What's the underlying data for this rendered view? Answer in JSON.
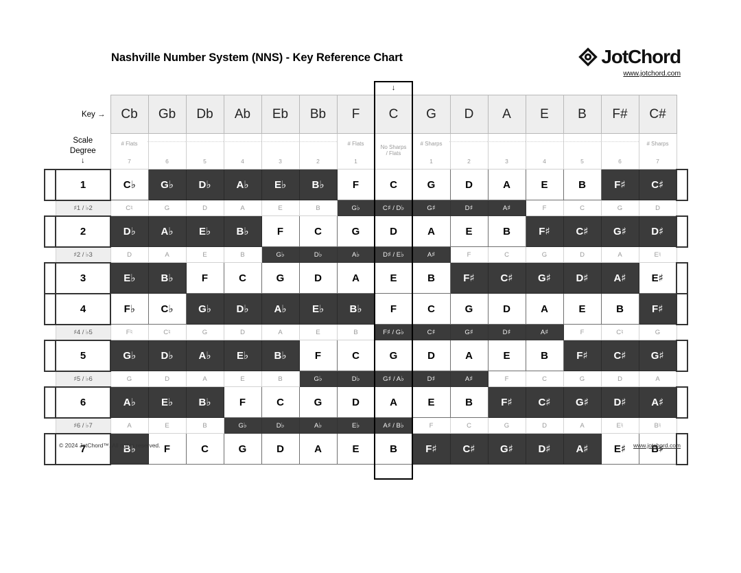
{
  "title": "Nashville Number System (NNS) - Key Reference Chart",
  "brand": {
    "name": "JotChord",
    "url": "www.jotchord.com",
    "logo_icon": "diamond-logo-icon"
  },
  "labels": {
    "key_label": "Key →",
    "scale_degree_label_line1": "Scale",
    "scale_degree_label_line2": "Degree",
    "scale_degree_arrow": "↓",
    "highlight_arrow": "↓"
  },
  "footer": {
    "copyright": "© 2024 JotChord™. All rights reserved.",
    "url": "www.jotchord.com"
  },
  "highlight_key": "C",
  "colors": {
    "dark_cell": "#3b3b3b",
    "light_cell": "#ffffff",
    "header_cell": "#eeeeee",
    "muted_text": "#9a9a9a"
  },
  "keys": [
    "Cb",
    "Gb",
    "Db",
    "Ab",
    "Eb",
    "Bb",
    "F",
    "C",
    "G",
    "D",
    "A",
    "E",
    "B",
    "F#",
    "C#"
  ],
  "accidentals": {
    "labels": [
      "# Flats",
      "",
      "",
      "",
      "",
      "",
      "# Flats",
      "No Sharps\n/ Flats",
      "# Sharps",
      "",
      "",
      "",
      "",
      "",
      "# Sharps"
    ],
    "counts": [
      "7",
      "6",
      "5",
      "4",
      "3",
      "2",
      "1",
      "",
      "1",
      "2",
      "3",
      "4",
      "5",
      "6",
      "7"
    ]
  },
  "rows": [
    {
      "kind": "degree",
      "degree": "1",
      "cells": [
        {
          "t": "C♭",
          "d": false
        },
        {
          "t": "G♭",
          "d": true
        },
        {
          "t": "D♭",
          "d": true
        },
        {
          "t": "A♭",
          "d": true
        },
        {
          "t": "E♭",
          "d": true
        },
        {
          "t": "B♭",
          "d": true
        },
        {
          "t": "F",
          "d": false
        },
        {
          "t": "C",
          "d": false
        },
        {
          "t": "G",
          "d": false
        },
        {
          "t": "D",
          "d": false
        },
        {
          "t": "A",
          "d": false
        },
        {
          "t": "E",
          "d": false
        },
        {
          "t": "B",
          "d": false
        },
        {
          "t": "F♯",
          "d": true
        },
        {
          "t": "C♯",
          "d": true
        }
      ]
    },
    {
      "kind": "chrom",
      "label": "♯1 / ♭2",
      "cells": [
        {
          "t": "C♮",
          "d": false
        },
        {
          "t": "G",
          "d": false
        },
        {
          "t": "D",
          "d": false
        },
        {
          "t": "A",
          "d": false
        },
        {
          "t": "E",
          "d": false
        },
        {
          "t": "B",
          "d": false
        },
        {
          "t": "G♭",
          "d": true
        },
        {
          "t": "C♯ / D♭",
          "d": true
        },
        {
          "t": "G♯",
          "d": true
        },
        {
          "t": "D♯",
          "d": true
        },
        {
          "t": "A♯",
          "d": true
        },
        {
          "t": "F",
          "d": false
        },
        {
          "t": "C",
          "d": false
        },
        {
          "t": "G",
          "d": false
        },
        {
          "t": "D",
          "d": false
        }
      ]
    },
    {
      "kind": "degree",
      "degree": "2",
      "cells": [
        {
          "t": "D♭",
          "d": true
        },
        {
          "t": "A♭",
          "d": true
        },
        {
          "t": "E♭",
          "d": true
        },
        {
          "t": "B♭",
          "d": true
        },
        {
          "t": "F",
          "d": false
        },
        {
          "t": "C",
          "d": false
        },
        {
          "t": "G",
          "d": false
        },
        {
          "t": "D",
          "d": false
        },
        {
          "t": "A",
          "d": false
        },
        {
          "t": "E",
          "d": false
        },
        {
          "t": "B",
          "d": false
        },
        {
          "t": "F♯",
          "d": true
        },
        {
          "t": "C♯",
          "d": true
        },
        {
          "t": "G♯",
          "d": true
        },
        {
          "t": "D♯",
          "d": true
        }
      ]
    },
    {
      "kind": "chrom",
      "label": "♯2 / ♭3",
      "cells": [
        {
          "t": "D",
          "d": false
        },
        {
          "t": "A",
          "d": false
        },
        {
          "t": "E",
          "d": false
        },
        {
          "t": "B",
          "d": false
        },
        {
          "t": "G♭",
          "d": true
        },
        {
          "t": "D♭",
          "d": true
        },
        {
          "t": "A♭",
          "d": true
        },
        {
          "t": "D♯ / E♭",
          "d": true
        },
        {
          "t": "A♯",
          "d": true
        },
        {
          "t": "F",
          "d": false
        },
        {
          "t": "C",
          "d": false
        },
        {
          "t": "G",
          "d": false
        },
        {
          "t": "D",
          "d": false
        },
        {
          "t": "A",
          "d": false
        },
        {
          "t": "E♮",
          "d": false
        }
      ]
    },
    {
      "kind": "degree",
      "degree": "3",
      "cells": [
        {
          "t": "E♭",
          "d": true
        },
        {
          "t": "B♭",
          "d": true
        },
        {
          "t": "F",
          "d": false
        },
        {
          "t": "C",
          "d": false
        },
        {
          "t": "G",
          "d": false
        },
        {
          "t": "D",
          "d": false
        },
        {
          "t": "A",
          "d": false
        },
        {
          "t": "E",
          "d": false
        },
        {
          "t": "B",
          "d": false
        },
        {
          "t": "F♯",
          "d": true
        },
        {
          "t": "C♯",
          "d": true
        },
        {
          "t": "G♯",
          "d": true
        },
        {
          "t": "D♯",
          "d": true
        },
        {
          "t": "A♯",
          "d": true
        },
        {
          "t": "E♯",
          "d": false
        }
      ]
    },
    {
      "kind": "degree",
      "degree": "4",
      "cells": [
        {
          "t": "F♭",
          "d": false
        },
        {
          "t": "C♭",
          "d": false
        },
        {
          "t": "G♭",
          "d": true
        },
        {
          "t": "D♭",
          "d": true
        },
        {
          "t": "A♭",
          "d": true
        },
        {
          "t": "E♭",
          "d": true
        },
        {
          "t": "B♭",
          "d": true
        },
        {
          "t": "F",
          "d": false
        },
        {
          "t": "C",
          "d": false
        },
        {
          "t": "G",
          "d": false
        },
        {
          "t": "D",
          "d": false
        },
        {
          "t": "A",
          "d": false
        },
        {
          "t": "E",
          "d": false
        },
        {
          "t": "B",
          "d": false
        },
        {
          "t": "F♯",
          "d": true
        }
      ]
    },
    {
      "kind": "chrom",
      "label": "♯4 / ♭5",
      "cells": [
        {
          "t": "F♮",
          "d": false
        },
        {
          "t": "C♮",
          "d": false
        },
        {
          "t": "G",
          "d": false
        },
        {
          "t": "D",
          "d": false
        },
        {
          "t": "A",
          "d": false
        },
        {
          "t": "E",
          "d": false
        },
        {
          "t": "B",
          "d": false
        },
        {
          "t": "F♯ / G♭",
          "d": true
        },
        {
          "t": "C♯",
          "d": true
        },
        {
          "t": "G♯",
          "d": true
        },
        {
          "t": "D♯",
          "d": true
        },
        {
          "t": "A♯",
          "d": true
        },
        {
          "t": "F",
          "d": false
        },
        {
          "t": "C♮",
          "d": false
        },
        {
          "t": "G",
          "d": false
        }
      ]
    },
    {
      "kind": "degree",
      "degree": "5",
      "cells": [
        {
          "t": "G♭",
          "d": true
        },
        {
          "t": "D♭",
          "d": true
        },
        {
          "t": "A♭",
          "d": true
        },
        {
          "t": "E♭",
          "d": true
        },
        {
          "t": "B♭",
          "d": true
        },
        {
          "t": "F",
          "d": false
        },
        {
          "t": "C",
          "d": false
        },
        {
          "t": "G",
          "d": false
        },
        {
          "t": "D",
          "d": false
        },
        {
          "t": "A",
          "d": false
        },
        {
          "t": "E",
          "d": false
        },
        {
          "t": "B",
          "d": false
        },
        {
          "t": "F♯",
          "d": true
        },
        {
          "t": "C♯",
          "d": true
        },
        {
          "t": "G♯",
          "d": true
        }
      ]
    },
    {
      "kind": "chrom",
      "label": "♯5 / ♭6",
      "cells": [
        {
          "t": "G",
          "d": false
        },
        {
          "t": "D",
          "d": false
        },
        {
          "t": "A",
          "d": false
        },
        {
          "t": "E",
          "d": false
        },
        {
          "t": "B",
          "d": false
        },
        {
          "t": "G♭",
          "d": true
        },
        {
          "t": "D♭",
          "d": true
        },
        {
          "t": "G♯ / A♭",
          "d": true
        },
        {
          "t": "D♯",
          "d": true
        },
        {
          "t": "A♯",
          "d": true
        },
        {
          "t": "F",
          "d": false
        },
        {
          "t": "C",
          "d": false
        },
        {
          "t": "G",
          "d": false
        },
        {
          "t": "D",
          "d": false
        },
        {
          "t": "A",
          "d": false
        }
      ]
    },
    {
      "kind": "degree",
      "degree": "6",
      "cells": [
        {
          "t": "A♭",
          "d": true
        },
        {
          "t": "E♭",
          "d": true
        },
        {
          "t": "B♭",
          "d": true
        },
        {
          "t": "F",
          "d": false
        },
        {
          "t": "C",
          "d": false
        },
        {
          "t": "G",
          "d": false
        },
        {
          "t": "D",
          "d": false
        },
        {
          "t": "A",
          "d": false
        },
        {
          "t": "E",
          "d": false
        },
        {
          "t": "B",
          "d": false
        },
        {
          "t": "F♯",
          "d": true
        },
        {
          "t": "C♯",
          "d": true
        },
        {
          "t": "G♯",
          "d": true
        },
        {
          "t": "D♯",
          "d": true
        },
        {
          "t": "A♯",
          "d": true
        }
      ]
    },
    {
      "kind": "chrom",
      "label": "♯6 / ♭7",
      "cells": [
        {
          "t": "A",
          "d": false
        },
        {
          "t": "E",
          "d": false
        },
        {
          "t": "B",
          "d": false
        },
        {
          "t": "G♭",
          "d": true
        },
        {
          "t": "D♭",
          "d": true
        },
        {
          "t": "A♭",
          "d": true
        },
        {
          "t": "E♭",
          "d": true
        },
        {
          "t": "A♯ / B♭",
          "d": true
        },
        {
          "t": "F",
          "d": false
        },
        {
          "t": "C",
          "d": false
        },
        {
          "t": "G",
          "d": false
        },
        {
          "t": "D",
          "d": false
        },
        {
          "t": "A",
          "d": false
        },
        {
          "t": "E♮",
          "d": false
        },
        {
          "t": "B♮",
          "d": false
        }
      ]
    },
    {
      "kind": "degree",
      "degree": "7",
      "cells": [
        {
          "t": "B♭",
          "d": true
        },
        {
          "t": "F",
          "d": false
        },
        {
          "t": "C",
          "d": false
        },
        {
          "t": "G",
          "d": false
        },
        {
          "t": "D",
          "d": false
        },
        {
          "t": "A",
          "d": false
        },
        {
          "t": "E",
          "d": false
        },
        {
          "t": "B",
          "d": false
        },
        {
          "t": "F♯",
          "d": true
        },
        {
          "t": "C♯",
          "d": true
        },
        {
          "t": "G♯",
          "d": true
        },
        {
          "t": "D♯",
          "d": true
        },
        {
          "t": "A♯",
          "d": true
        },
        {
          "t": "E♯",
          "d": false
        },
        {
          "t": "B♯",
          "d": false
        }
      ]
    }
  ]
}
